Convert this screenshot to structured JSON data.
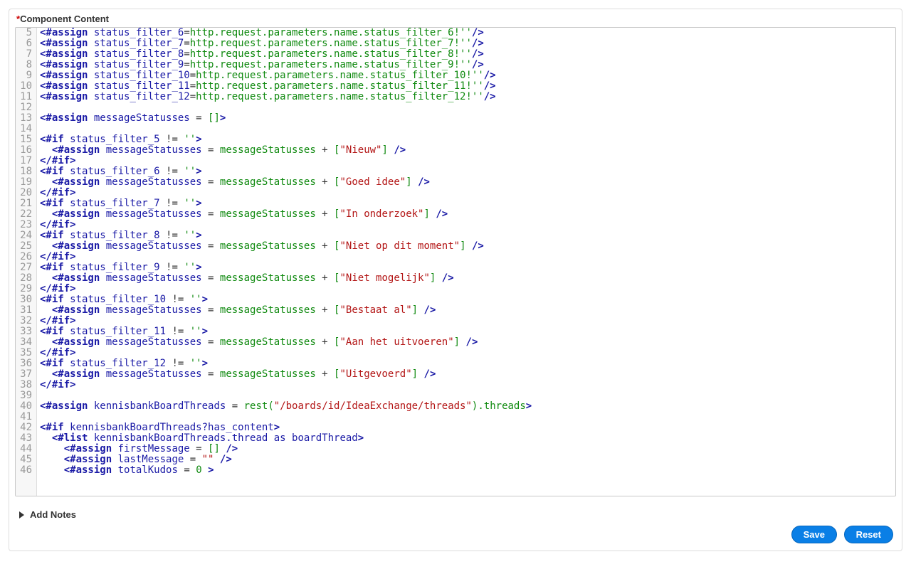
{
  "header": {
    "label": "Component Content",
    "required_marker": "*"
  },
  "add_notes_label": "Add Notes",
  "buttons": {
    "save": "Save",
    "reset": "Reset"
  },
  "editor": {
    "first_line_number": 5,
    "lines": [
      [
        {
          "c": "tag",
          "t": "<#assign"
        },
        {
          "c": "plain",
          "t": " "
        },
        {
          "c": "attr",
          "t": "status_filter_6"
        },
        {
          "c": "eq",
          "t": "="
        },
        {
          "c": "val",
          "t": "http.request.parameters.name.status_filter_6!''"
        },
        {
          "c": "tag",
          "t": "/>"
        }
      ],
      [
        {
          "c": "tag",
          "t": "<#assign"
        },
        {
          "c": "plain",
          "t": " "
        },
        {
          "c": "attr",
          "t": "status_filter_7"
        },
        {
          "c": "eq",
          "t": "="
        },
        {
          "c": "val",
          "t": "http.request.parameters.name.status_filter_7!''"
        },
        {
          "c": "tag",
          "t": "/>"
        }
      ],
      [
        {
          "c": "tag",
          "t": "<#assign"
        },
        {
          "c": "plain",
          "t": " "
        },
        {
          "c": "attr",
          "t": "status_filter_8"
        },
        {
          "c": "eq",
          "t": "="
        },
        {
          "c": "val",
          "t": "http.request.parameters.name.status_filter_8!''"
        },
        {
          "c": "tag",
          "t": "/>"
        }
      ],
      [
        {
          "c": "tag",
          "t": "<#assign"
        },
        {
          "c": "plain",
          "t": " "
        },
        {
          "c": "attr",
          "t": "status_filter_9"
        },
        {
          "c": "eq",
          "t": "="
        },
        {
          "c": "val",
          "t": "http.request.parameters.name.status_filter_9!''"
        },
        {
          "c": "tag",
          "t": "/>"
        }
      ],
      [
        {
          "c": "tag",
          "t": "<#assign"
        },
        {
          "c": "plain",
          "t": " "
        },
        {
          "c": "attr",
          "t": "status_filter_10"
        },
        {
          "c": "eq",
          "t": "="
        },
        {
          "c": "val",
          "t": "http.request.parameters.name.status_filter_10!''"
        },
        {
          "c": "tag",
          "t": "/>"
        }
      ],
      [
        {
          "c": "tag",
          "t": "<#assign"
        },
        {
          "c": "plain",
          "t": " "
        },
        {
          "c": "attr",
          "t": "status_filter_11"
        },
        {
          "c": "eq",
          "t": "="
        },
        {
          "c": "val",
          "t": "http.request.parameters.name.status_filter_11!''"
        },
        {
          "c": "tag",
          "t": "/>"
        }
      ],
      [
        {
          "c": "tag",
          "t": "<#assign"
        },
        {
          "c": "plain",
          "t": " "
        },
        {
          "c": "attr",
          "t": "status_filter_12"
        },
        {
          "c": "eq",
          "t": "="
        },
        {
          "c": "val",
          "t": "http.request.parameters.name.status_filter_12!''"
        },
        {
          "c": "tag",
          "t": "/>"
        }
      ],
      [],
      [
        {
          "c": "tag",
          "t": "<#assign"
        },
        {
          "c": "plain",
          "t": " "
        },
        {
          "c": "attr",
          "t": "messageStatusses"
        },
        {
          "c": "plain",
          "t": " = "
        },
        {
          "c": "val",
          "t": "[]"
        },
        {
          "c": "tag",
          "t": ">"
        }
      ],
      [],
      [
        {
          "c": "tag",
          "t": "<#if"
        },
        {
          "c": "plain",
          "t": " "
        },
        {
          "c": "attr",
          "t": "status_filter_5"
        },
        {
          "c": "plain",
          "t": " != "
        },
        {
          "c": "val",
          "t": "''"
        },
        {
          "c": "tag",
          "t": ">"
        }
      ],
      [
        {
          "c": "plain",
          "t": "  "
        },
        {
          "c": "tag",
          "t": "<#assign"
        },
        {
          "c": "plain",
          "t": " "
        },
        {
          "c": "attr",
          "t": "messageStatusses"
        },
        {
          "c": "plain",
          "t": " = "
        },
        {
          "c": "val",
          "t": "messageStatusses"
        },
        {
          "c": "plain",
          "t": " + "
        },
        {
          "c": "val",
          "t": "["
        },
        {
          "c": "str",
          "t": "\"Nieuw\""
        },
        {
          "c": "val",
          "t": "]"
        },
        {
          "c": "plain",
          "t": " "
        },
        {
          "c": "tag",
          "t": "/>"
        }
      ],
      [
        {
          "c": "tag",
          "t": "</#if>"
        }
      ],
      [
        {
          "c": "tag",
          "t": "<#if"
        },
        {
          "c": "plain",
          "t": " "
        },
        {
          "c": "attr",
          "t": "status_filter_6"
        },
        {
          "c": "plain",
          "t": " != "
        },
        {
          "c": "val",
          "t": "''"
        },
        {
          "c": "tag",
          "t": ">"
        }
      ],
      [
        {
          "c": "plain",
          "t": "  "
        },
        {
          "c": "tag",
          "t": "<#assign"
        },
        {
          "c": "plain",
          "t": " "
        },
        {
          "c": "attr",
          "t": "messageStatusses"
        },
        {
          "c": "plain",
          "t": " = "
        },
        {
          "c": "val",
          "t": "messageStatusses"
        },
        {
          "c": "plain",
          "t": " + "
        },
        {
          "c": "val",
          "t": "["
        },
        {
          "c": "str",
          "t": "\"Goed idee\""
        },
        {
          "c": "val",
          "t": "]"
        },
        {
          "c": "plain",
          "t": " "
        },
        {
          "c": "tag",
          "t": "/>"
        }
      ],
      [
        {
          "c": "tag",
          "t": "</#if>"
        }
      ],
      [
        {
          "c": "tag",
          "t": "<#if"
        },
        {
          "c": "plain",
          "t": " "
        },
        {
          "c": "attr",
          "t": "status_filter_7"
        },
        {
          "c": "plain",
          "t": " != "
        },
        {
          "c": "val",
          "t": "''"
        },
        {
          "c": "tag",
          "t": ">"
        }
      ],
      [
        {
          "c": "plain",
          "t": "  "
        },
        {
          "c": "tag",
          "t": "<#assign"
        },
        {
          "c": "plain",
          "t": " "
        },
        {
          "c": "attr",
          "t": "messageStatusses"
        },
        {
          "c": "plain",
          "t": " = "
        },
        {
          "c": "val",
          "t": "messageStatusses"
        },
        {
          "c": "plain",
          "t": " + "
        },
        {
          "c": "val",
          "t": "["
        },
        {
          "c": "str",
          "t": "\"In onderzoek\""
        },
        {
          "c": "val",
          "t": "]"
        },
        {
          "c": "plain",
          "t": " "
        },
        {
          "c": "tag",
          "t": "/>"
        }
      ],
      [
        {
          "c": "tag",
          "t": "</#if>"
        }
      ],
      [
        {
          "c": "tag",
          "t": "<#if"
        },
        {
          "c": "plain",
          "t": " "
        },
        {
          "c": "attr",
          "t": "status_filter_8"
        },
        {
          "c": "plain",
          "t": " != "
        },
        {
          "c": "val",
          "t": "''"
        },
        {
          "c": "tag",
          "t": ">"
        }
      ],
      [
        {
          "c": "plain",
          "t": "  "
        },
        {
          "c": "tag",
          "t": "<#assign"
        },
        {
          "c": "plain",
          "t": " "
        },
        {
          "c": "attr",
          "t": "messageStatusses"
        },
        {
          "c": "plain",
          "t": " = "
        },
        {
          "c": "val",
          "t": "messageStatusses"
        },
        {
          "c": "plain",
          "t": " + "
        },
        {
          "c": "val",
          "t": "["
        },
        {
          "c": "str",
          "t": "\"Niet op dit moment\""
        },
        {
          "c": "val",
          "t": "]"
        },
        {
          "c": "plain",
          "t": " "
        },
        {
          "c": "tag",
          "t": "/>"
        }
      ],
      [
        {
          "c": "tag",
          "t": "</#if>"
        }
      ],
      [
        {
          "c": "tag",
          "t": "<#if"
        },
        {
          "c": "plain",
          "t": " "
        },
        {
          "c": "attr",
          "t": "status_filter_9"
        },
        {
          "c": "plain",
          "t": " != "
        },
        {
          "c": "val",
          "t": "''"
        },
        {
          "c": "tag",
          "t": ">"
        }
      ],
      [
        {
          "c": "plain",
          "t": "  "
        },
        {
          "c": "tag",
          "t": "<#assign"
        },
        {
          "c": "plain",
          "t": " "
        },
        {
          "c": "attr",
          "t": "messageStatusses"
        },
        {
          "c": "plain",
          "t": " = "
        },
        {
          "c": "val",
          "t": "messageStatusses"
        },
        {
          "c": "plain",
          "t": " + "
        },
        {
          "c": "val",
          "t": "["
        },
        {
          "c": "str",
          "t": "\"Niet mogelijk\""
        },
        {
          "c": "val",
          "t": "]"
        },
        {
          "c": "plain",
          "t": " "
        },
        {
          "c": "tag",
          "t": "/>"
        }
      ],
      [
        {
          "c": "tag",
          "t": "</#if>"
        }
      ],
      [
        {
          "c": "tag",
          "t": "<#if"
        },
        {
          "c": "plain",
          "t": " "
        },
        {
          "c": "attr",
          "t": "status_filter_10"
        },
        {
          "c": "plain",
          "t": " != "
        },
        {
          "c": "val",
          "t": "''"
        },
        {
          "c": "tag",
          "t": ">"
        }
      ],
      [
        {
          "c": "plain",
          "t": "  "
        },
        {
          "c": "tag",
          "t": "<#assign"
        },
        {
          "c": "plain",
          "t": " "
        },
        {
          "c": "attr",
          "t": "messageStatusses"
        },
        {
          "c": "plain",
          "t": " = "
        },
        {
          "c": "val",
          "t": "messageStatusses"
        },
        {
          "c": "plain",
          "t": " + "
        },
        {
          "c": "val",
          "t": "["
        },
        {
          "c": "str",
          "t": "\"Bestaat al\""
        },
        {
          "c": "val",
          "t": "]"
        },
        {
          "c": "plain",
          "t": " "
        },
        {
          "c": "tag",
          "t": "/>"
        }
      ],
      [
        {
          "c": "tag",
          "t": "</#if>"
        }
      ],
      [
        {
          "c": "tag",
          "t": "<#if"
        },
        {
          "c": "plain",
          "t": " "
        },
        {
          "c": "attr",
          "t": "status_filter_11"
        },
        {
          "c": "plain",
          "t": " != "
        },
        {
          "c": "val",
          "t": "''"
        },
        {
          "c": "tag",
          "t": ">"
        }
      ],
      [
        {
          "c": "plain",
          "t": "  "
        },
        {
          "c": "tag",
          "t": "<#assign"
        },
        {
          "c": "plain",
          "t": " "
        },
        {
          "c": "attr",
          "t": "messageStatusses"
        },
        {
          "c": "plain",
          "t": " = "
        },
        {
          "c": "val",
          "t": "messageStatusses"
        },
        {
          "c": "plain",
          "t": " + "
        },
        {
          "c": "val",
          "t": "["
        },
        {
          "c": "str",
          "t": "\"Aan het uitvoeren\""
        },
        {
          "c": "val",
          "t": "]"
        },
        {
          "c": "plain",
          "t": " "
        },
        {
          "c": "tag",
          "t": "/>"
        }
      ],
      [
        {
          "c": "tag",
          "t": "</#if>"
        }
      ],
      [
        {
          "c": "tag",
          "t": "<#if"
        },
        {
          "c": "plain",
          "t": " "
        },
        {
          "c": "attr",
          "t": "status_filter_12"
        },
        {
          "c": "plain",
          "t": " != "
        },
        {
          "c": "val",
          "t": "''"
        },
        {
          "c": "tag",
          "t": ">"
        }
      ],
      [
        {
          "c": "plain",
          "t": "  "
        },
        {
          "c": "tag",
          "t": "<#assign"
        },
        {
          "c": "plain",
          "t": " "
        },
        {
          "c": "attr",
          "t": "messageStatusses"
        },
        {
          "c": "plain",
          "t": " = "
        },
        {
          "c": "val",
          "t": "messageStatusses"
        },
        {
          "c": "plain",
          "t": " + "
        },
        {
          "c": "val",
          "t": "["
        },
        {
          "c": "str",
          "t": "\"Uitgevoerd\""
        },
        {
          "c": "val",
          "t": "]"
        },
        {
          "c": "plain",
          "t": " "
        },
        {
          "c": "tag",
          "t": "/>"
        }
      ],
      [
        {
          "c": "tag",
          "t": "</#if>"
        }
      ],
      [],
      [
        {
          "c": "tag",
          "t": "<#assign"
        },
        {
          "c": "plain",
          "t": " "
        },
        {
          "c": "attr",
          "t": "kennisbankBoardThreads"
        },
        {
          "c": "plain",
          "t": " = "
        },
        {
          "c": "val",
          "t": "rest("
        },
        {
          "c": "str",
          "t": "\"/boards/id/IdeaExchange/threads\""
        },
        {
          "c": "val",
          "t": ").threads"
        },
        {
          "c": "tag",
          "t": ">"
        }
      ],
      [],
      [
        {
          "c": "tag",
          "t": "<#if"
        },
        {
          "c": "plain",
          "t": " "
        },
        {
          "c": "attr",
          "t": "kennisbankBoardThreads?has_content"
        },
        {
          "c": "tag",
          "t": ">"
        }
      ],
      [
        {
          "c": "plain",
          "t": "  "
        },
        {
          "c": "tag",
          "t": "<#list"
        },
        {
          "c": "plain",
          "t": " "
        },
        {
          "c": "attr",
          "t": "kennisbankBoardThreads.thread as boardThread"
        },
        {
          "c": "tag",
          "t": ">"
        }
      ],
      [
        {
          "c": "plain",
          "t": "    "
        },
        {
          "c": "tag",
          "t": "<#assign"
        },
        {
          "c": "plain",
          "t": " "
        },
        {
          "c": "attr",
          "t": "firstMessage"
        },
        {
          "c": "plain",
          "t": " = "
        },
        {
          "c": "val",
          "t": "[]"
        },
        {
          "c": "plain",
          "t": " "
        },
        {
          "c": "tag",
          "t": "/>"
        }
      ],
      [
        {
          "c": "plain",
          "t": "    "
        },
        {
          "c": "tag",
          "t": "<#assign"
        },
        {
          "c": "plain",
          "t": " "
        },
        {
          "c": "attr",
          "t": "lastMessage"
        },
        {
          "c": "plain",
          "t": " = "
        },
        {
          "c": "str",
          "t": "\"\""
        },
        {
          "c": "plain",
          "t": " "
        },
        {
          "c": "tag",
          "t": "/>"
        }
      ],
      [
        {
          "c": "plain",
          "t": "    "
        },
        {
          "c": "tag",
          "t": "<#assign"
        },
        {
          "c": "plain",
          "t": " "
        },
        {
          "c": "attr",
          "t": "totalKudos"
        },
        {
          "c": "plain",
          "t": " = "
        },
        {
          "c": "val",
          "t": "0"
        },
        {
          "c": "plain",
          "t": " "
        },
        {
          "c": "tag",
          "t": ">"
        }
      ]
    ]
  }
}
